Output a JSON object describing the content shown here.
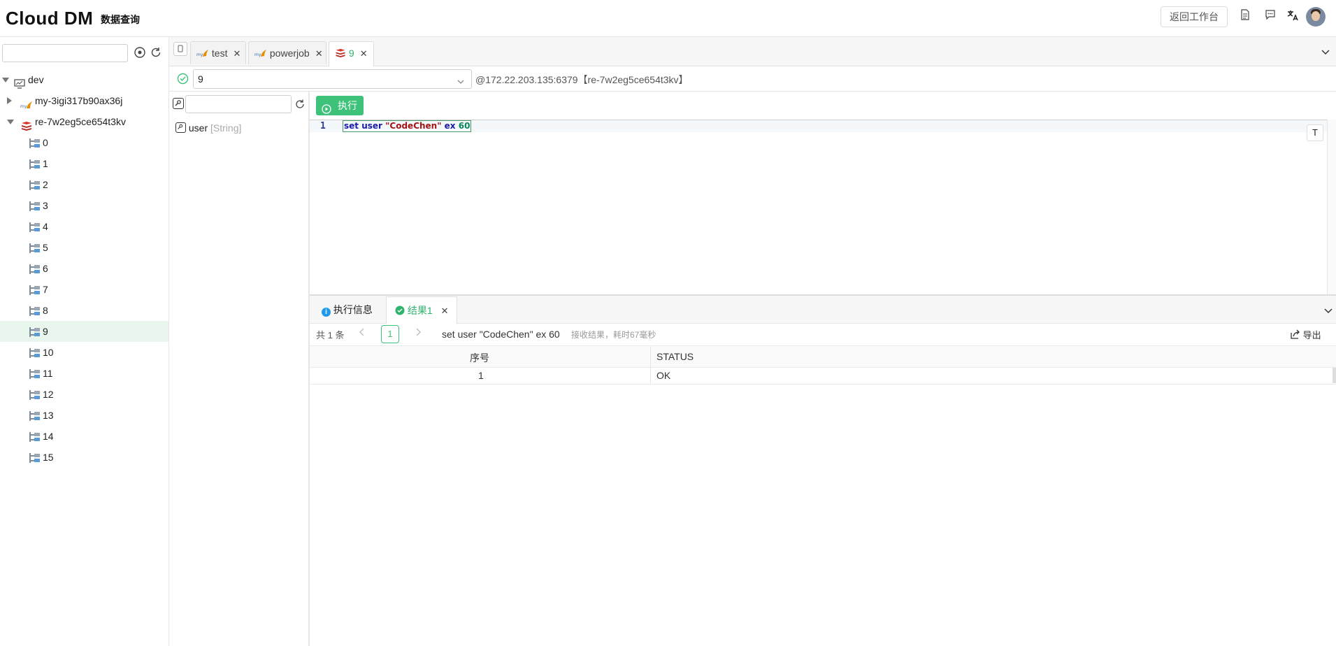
{
  "header": {
    "logo": "Clоud DM",
    "subtitle": "数据查询",
    "back_label": "返回工作台",
    "icons": [
      "document-icon",
      "chat-icon",
      "translate-icon",
      "user-avatar"
    ]
  },
  "sidebar": {
    "search_placeholder": "",
    "tree": {
      "root": "dev",
      "connections": [
        {
          "name": "my-3igi317b90ax36j",
          "type": "mysql",
          "expanded": false
        },
        {
          "name": "re-7w2eg5ce654t3kv",
          "type": "redis",
          "expanded": true
        }
      ],
      "databases": [
        "0",
        "1",
        "2",
        "3",
        "4",
        "5",
        "6",
        "7",
        "8",
        "9",
        "10",
        "11",
        "12",
        "13",
        "14",
        "15"
      ],
      "selected": "9"
    }
  },
  "tabs": [
    {
      "label": "test",
      "type": "mysql"
    },
    {
      "label": "powerjob",
      "type": "mysql"
    },
    {
      "label": "9",
      "type": "redis",
      "active": true
    }
  ],
  "connection": {
    "db_value": "9",
    "info": "@172.22.203.135:6379【re-7w2eg5ce654t3kv】"
  },
  "keys": {
    "search_placeholder": "",
    "items": [
      {
        "name": "user",
        "type": "[String]"
      }
    ]
  },
  "editor": {
    "run_label": "执行",
    "line_number": "1",
    "code": {
      "cmd": "set",
      "key": "user",
      "value": "\"CodeChen\"",
      "opt": "ex",
      "num": "60"
    },
    "t_button": "T"
  },
  "results": {
    "tabs": [
      {
        "label": "执行信息"
      },
      {
        "label": "结果1",
        "active": true
      }
    ],
    "total": "共 1 条",
    "page": "1",
    "query": "set user \"CodeChen\" ex 60",
    "timing": "接收结果，耗时67毫秒",
    "export_label": "导出",
    "columns": [
      "序号",
      "STATUS"
    ],
    "rows": [
      [
        "1",
        "OK"
      ]
    ]
  },
  "colors": {
    "accent": "#3ec27a",
    "selected_row": "#e8f6ee",
    "redis": "#d9352b"
  }
}
